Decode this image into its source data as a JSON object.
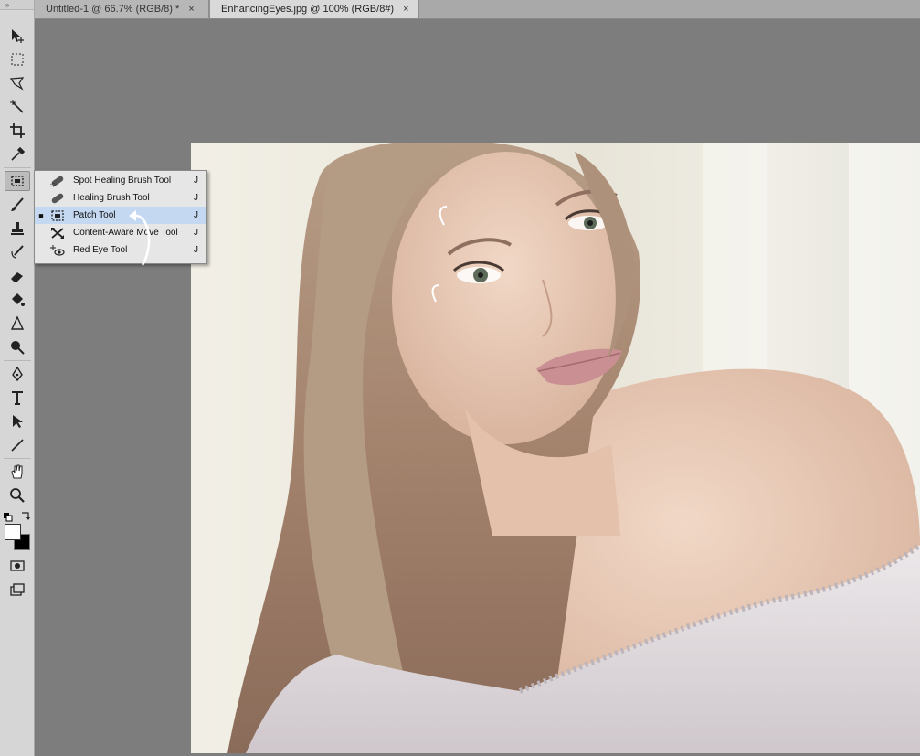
{
  "tabs": [
    {
      "label": "Untitled-1 @ 66.7% (RGB/8) *",
      "close": "×"
    },
    {
      "label": "EnhancingEyes.jpg @ 100% (RGB/8#)",
      "close": "×"
    }
  ],
  "toolbar": {
    "grip": "»",
    "tools": [
      "move-icon",
      "marquee-icon",
      "lasso-icon",
      "magic-wand-icon",
      "crop-icon",
      "eyedropper-icon",
      "patch-tool-icon",
      "brush-icon",
      "stamp-icon",
      "history-brush-icon",
      "eraser-icon",
      "bucket-icon",
      "blur-icon",
      "dodge-icon",
      "pen-icon",
      "type-icon",
      "path-selection-icon",
      "line-icon",
      "hand-icon",
      "zoom-icon"
    ],
    "foreground_color": "#ffffff",
    "background_color": "#000000"
  },
  "flyout": {
    "items": [
      {
        "label": "Spot Healing Brush Tool",
        "key": "J",
        "icon": "spot-healing-icon",
        "selected": false
      },
      {
        "label": "Healing Brush Tool",
        "key": "J",
        "icon": "healing-brush-icon",
        "selected": false
      },
      {
        "label": "Patch Tool",
        "key": "J",
        "icon": "patch-icon",
        "selected": true
      },
      {
        "label": "Content-Aware Move Tool",
        "key": "J",
        "icon": "content-aware-move-icon",
        "selected": false
      },
      {
        "label": "Red Eye Tool",
        "key": "J",
        "icon": "red-eye-icon",
        "selected": false
      }
    ],
    "selected_marker": "■"
  },
  "colors": {
    "workspace": "#7d7d7d",
    "toolbar": "#d6d6d6",
    "selection_highlight": "#c4d8f2"
  }
}
